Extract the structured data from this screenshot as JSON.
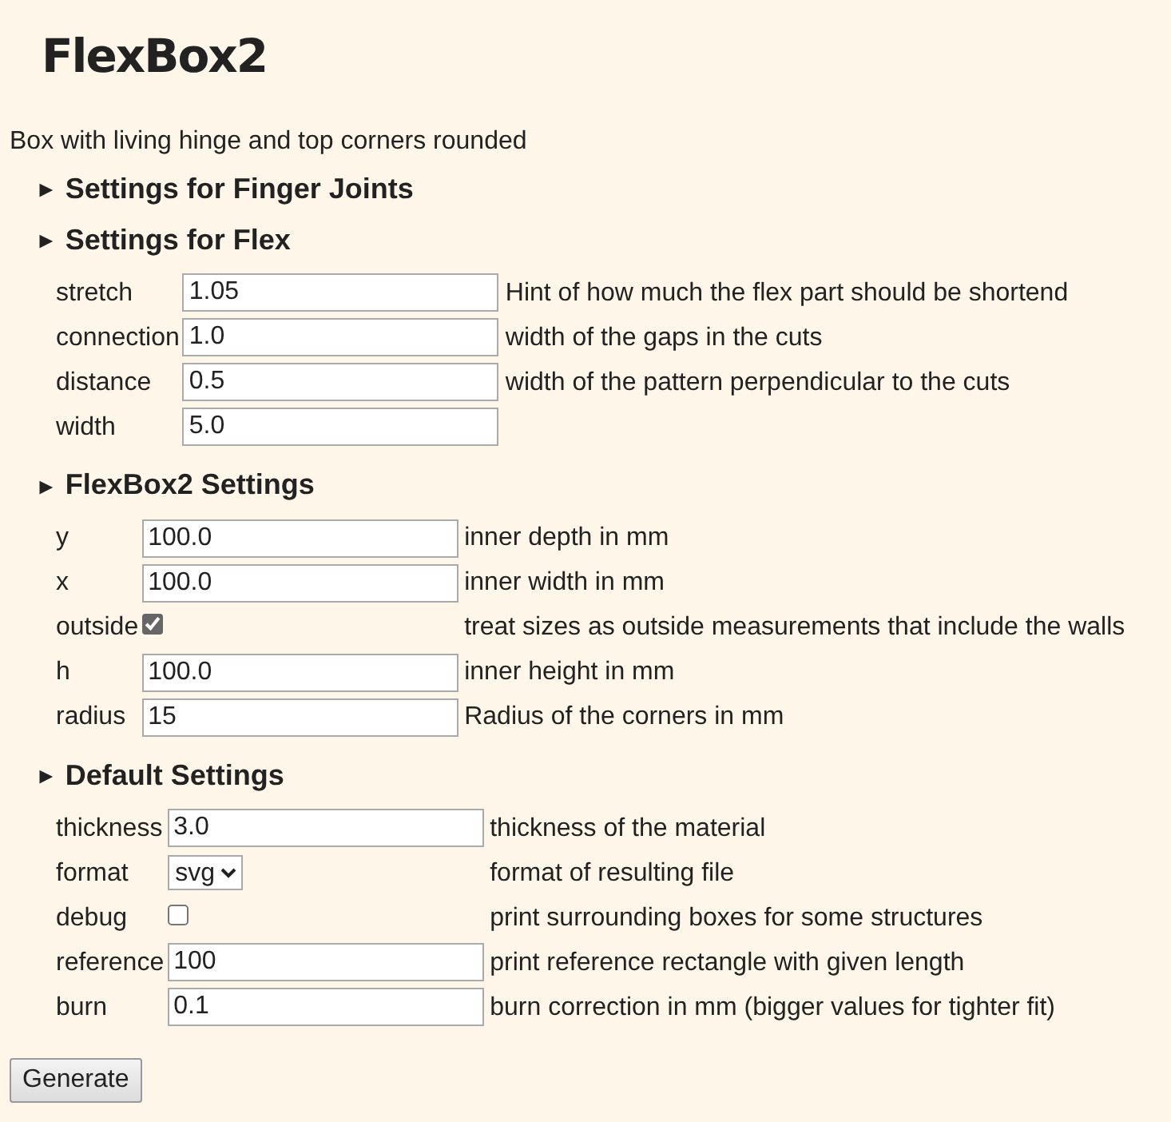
{
  "title": "FlexBox2",
  "description": "Box with living hinge and top corners rounded",
  "sections": [
    {
      "toggle": "►",
      "heading": "Settings for Finger Joints"
    },
    {
      "toggle": "►",
      "heading": "Settings for Flex",
      "rows": [
        {
          "kind": "text",
          "label": "stretch",
          "value": "1.05",
          "help": "Hint of how much the flex part should be shortend"
        },
        {
          "kind": "text",
          "label": "connection",
          "value": "1.0",
          "help": "width of the gaps in the cuts"
        },
        {
          "kind": "text",
          "label": "distance",
          "value": "0.5",
          "help": "width of the pattern perpendicular to the cuts"
        },
        {
          "kind": "text",
          "label": "width",
          "value": "5.0"
        }
      ]
    },
    {
      "toggle": "►",
      "heading": "FlexBox2 Settings",
      "rows": [
        {
          "kind": "text",
          "label": "y",
          "value": "100.0",
          "help": "inner depth in mm"
        },
        {
          "kind": "text",
          "label": "x",
          "value": "100.0",
          "help": "inner width in mm"
        },
        {
          "kind": "checkbox",
          "label": "outside",
          "checked": true,
          "help": "treat sizes as outside measurements that include the walls"
        },
        {
          "kind": "text",
          "label": "h",
          "value": "100.0",
          "help": "inner height in mm"
        },
        {
          "kind": "text",
          "label": "radius",
          "value": "15",
          "help": "Radius of the corners in mm"
        }
      ]
    },
    {
      "toggle": "►",
      "heading": "Default Settings",
      "rows": [
        {
          "kind": "text",
          "label": "thickness",
          "value": "3.0",
          "help": "thickness of the material"
        },
        {
          "kind": "select",
          "label": "format",
          "value": "svg",
          "help": "format of resulting file"
        },
        {
          "kind": "checkbox",
          "label": "debug",
          "checked": false,
          "help": "print surrounding boxes for some structures"
        },
        {
          "kind": "text",
          "label": "reference",
          "value": "100",
          "help": "print reference rectangle with given length"
        },
        {
          "kind": "text",
          "label": "burn",
          "value": "0.1",
          "help": "burn correction in mm (bigger values for tighter fit)"
        }
      ]
    }
  ],
  "button": "Generate"
}
